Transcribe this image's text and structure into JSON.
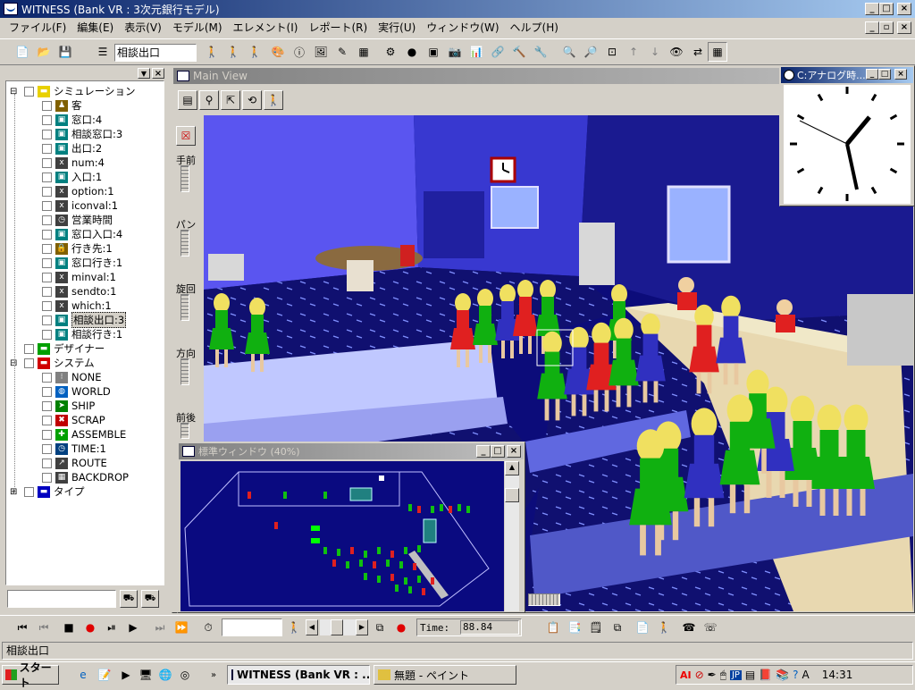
{
  "app": {
    "title": "WITNESS (Bank VR : 3次元銀行モデル)"
  },
  "menu": [
    "ファイル(F)",
    "編集(E)",
    "表示(V)",
    "モデル(M)",
    "エレメント(I)",
    "レポート(R)",
    "実行(U)",
    "ウィンドウ(W)",
    "ヘルプ(H)"
  ],
  "toolbar": {
    "element_select_value": "相談出口"
  },
  "tree": {
    "items": [
      {
        "label": "シミュレーション",
        "level": 0,
        "expander": "⊟",
        "icon": "folder",
        "color": "#e8d000"
      },
      {
        "label": "客",
        "level": 1,
        "icon": "person",
        "color": "#806000"
      },
      {
        "label": "窓口:4",
        "level": 1,
        "icon": "machine",
        "color": "#008080"
      },
      {
        "label": "相談窓口:3",
        "level": 1,
        "icon": "machine",
        "color": "#008080"
      },
      {
        "label": "出口:2",
        "level": 1,
        "icon": "machine",
        "color": "#008080"
      },
      {
        "label": "num:4",
        "level": 1,
        "icon": "variable",
        "color": "#404040"
      },
      {
        "label": "入口:1",
        "level": 1,
        "icon": "machine",
        "color": "#008080"
      },
      {
        "label": "option:1",
        "level": 1,
        "icon": "variable",
        "color": "#404040"
      },
      {
        "label": "iconval:1",
        "level": 1,
        "icon": "variable",
        "color": "#404040"
      },
      {
        "label": "営業時間",
        "level": 1,
        "icon": "clock",
        "color": "#404040"
      },
      {
        "label": "窓口入口:4",
        "level": 1,
        "icon": "machine",
        "color": "#008080"
      },
      {
        "label": "行き先:1",
        "level": 1,
        "icon": "lock",
        "color": "#806000"
      },
      {
        "label": "窓口行き:1",
        "level": 1,
        "icon": "machine",
        "color": "#008080"
      },
      {
        "label": "minval:1",
        "level": 1,
        "icon": "variable",
        "color": "#404040"
      },
      {
        "label": "sendto:1",
        "level": 1,
        "icon": "variable",
        "color": "#404040"
      },
      {
        "label": "which:1",
        "level": 1,
        "icon": "variable",
        "color": "#404040"
      },
      {
        "label": "相談出口:3",
        "level": 1,
        "icon": "machine",
        "color": "#008080",
        "selected": true
      },
      {
        "label": "相談行き:1",
        "level": 1,
        "icon": "machine",
        "color": "#008080"
      },
      {
        "label": "デザイナー",
        "level": 0,
        "icon": "folder",
        "color": "#00a000"
      },
      {
        "label": "システム",
        "level": 0,
        "expander": "⊟",
        "icon": "folder",
        "color": "#d00000"
      },
      {
        "label": "NONE",
        "level": 1,
        "icon": "none",
        "color": "#808080"
      },
      {
        "label": "WORLD",
        "level": 1,
        "icon": "globe",
        "color": "#0060c0"
      },
      {
        "label": "SHIP",
        "level": 1,
        "icon": "ship",
        "color": "#008000"
      },
      {
        "label": "SCRAP",
        "level": 1,
        "icon": "scrap",
        "color": "#c00000"
      },
      {
        "label": "ASSEMBLE",
        "level": 1,
        "icon": "assemble",
        "color": "#00a000"
      },
      {
        "label": "TIME:1",
        "level": 1,
        "icon": "time",
        "color": "#004080"
      },
      {
        "label": "ROUTE",
        "level": 1,
        "icon": "route",
        "color": "#404040"
      },
      {
        "label": "BACKDROP",
        "level": 1,
        "icon": "backdrop",
        "color": "#404040"
      },
      {
        "label": "タイプ",
        "level": 0,
        "expander": "⊞",
        "icon": "folder",
        "color": "#0000c0"
      }
    ]
  },
  "main_view": {
    "title": "Main View",
    "side_labels": [
      "手前",
      "パン",
      "旋回",
      "方向",
      "前後"
    ]
  },
  "clock_window": {
    "title": "C:アナログ時..."
  },
  "std_window": {
    "title": "標準ウィンドウ (40%)"
  },
  "run_bar": {
    "time_label": "Time:",
    "time_value": "88.84"
  },
  "status_bar": {
    "text": "相談出口"
  },
  "taskbar": {
    "start_label": "スタート",
    "tasks": [
      {
        "label": "WITNESS (Bank VR : ...",
        "active": true
      },
      {
        "label": "無題 - ペイント",
        "active": false
      }
    ],
    "tray_time": "14:31",
    "tray_lang": "JP"
  }
}
